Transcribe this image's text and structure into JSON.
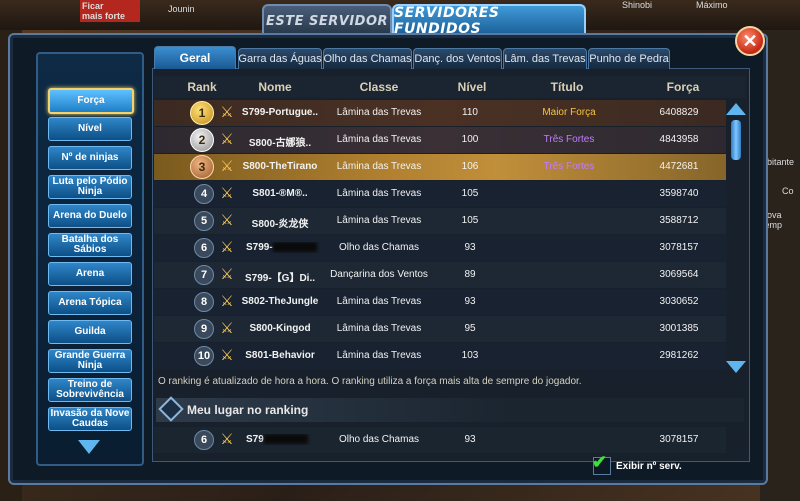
{
  "background": {
    "tag_ficar": "Ficar\nmais forte",
    "tag_jounin": "Jounin",
    "tag_shinobi": "Shinobi",
    "tag_maximo": "Máximo",
    "tag_ebitante": "ebitante",
    "tag_co": "Co",
    "tag_nova_temp": "nova temp"
  },
  "top_tabs": {
    "this_server": "ESTE SERVIDOR",
    "merged_servers": "SERVIDORES FUNDIDOS"
  },
  "close_icon": "close-icon",
  "sidebar": {
    "items": [
      {
        "label": "Força",
        "active": true
      },
      {
        "label": "Nível"
      },
      {
        "label": "Nº de ninjas"
      },
      {
        "label": "Luta pelo Pódio Ninja"
      },
      {
        "label": "Arena do Duelo"
      },
      {
        "label": "Batalha dos Sábios"
      },
      {
        "label": "Arena"
      },
      {
        "label": "Arena Tópica"
      },
      {
        "label": "Guilda"
      },
      {
        "label": "Grande Guerra Ninja"
      },
      {
        "label": "Treino de Sobrevivência"
      },
      {
        "label": "Invasão da Nove Caudas"
      }
    ]
  },
  "subtabs": [
    {
      "label": "Geral",
      "active": true
    },
    {
      "label": "Garra das Águas"
    },
    {
      "label": "Olho das Chamas"
    },
    {
      "label": "Danç. dos Ventos"
    },
    {
      "label": "Lâm. das Trevas"
    },
    {
      "label": "Punho de Pedra"
    }
  ],
  "table": {
    "headers": {
      "rank": "Rank",
      "name": "Nome",
      "class": "Classe",
      "level": "Nível",
      "title": "Título",
      "power": "Força"
    },
    "rows": [
      {
        "rank": "1",
        "name": "S799-Portugue..",
        "class": "Lâmina das Trevas",
        "level": "110",
        "title": "Maior Força",
        "power": "6408829"
      },
      {
        "rank": "2",
        "name": "S800-古娜狼..",
        "class": "Lâmina das Trevas",
        "level": "100",
        "title": "Três Fortes",
        "power": "4843958"
      },
      {
        "rank": "3",
        "name": "S800-TheTirano",
        "class": "Lâmina das Trevas",
        "level": "106",
        "title": "Três Fortes",
        "power": "4472681"
      },
      {
        "rank": "4",
        "name": "S801-®M®..",
        "class": "Lâmina das Trevas",
        "level": "105",
        "title": "",
        "power": "3598740"
      },
      {
        "rank": "5",
        "name": "S800-炎龙侠",
        "class": "Lâmina das Trevas",
        "level": "105",
        "title": "",
        "power": "3588712"
      },
      {
        "rank": "6",
        "name": "S799-",
        "class": "Olho das Chamas",
        "level": "93",
        "title": "",
        "power": "3078157"
      },
      {
        "rank": "7",
        "name": "S799-【G】Di..",
        "class": "Dançarina dos Ventos",
        "level": "89",
        "title": "",
        "power": "3069564"
      },
      {
        "rank": "8",
        "name": "S802-TheJungle",
        "class": "Lâmina das Trevas",
        "level": "93",
        "title": "",
        "power": "3030652"
      },
      {
        "rank": "9",
        "name": "S800-Kingod",
        "class": "Lâmina das Trevas",
        "level": "95",
        "title": "",
        "power": "3001385"
      },
      {
        "rank": "10",
        "name": "S801-Behavior",
        "class": "Lâmina das Trevas",
        "level": "103",
        "title": "",
        "power": "2981262"
      }
    ]
  },
  "info_text": "O ranking é atualizado de hora a hora. O ranking utiliza a força mais alta de sempre do jogador.",
  "my_rank": {
    "label": "Meu lugar no ranking",
    "rank": "6",
    "name": "S79",
    "class": "Olho das Chamas",
    "level": "93",
    "power": "3078157"
  },
  "show_server_checkbox": {
    "label": "Exibir nº serv.",
    "checked": true
  }
}
